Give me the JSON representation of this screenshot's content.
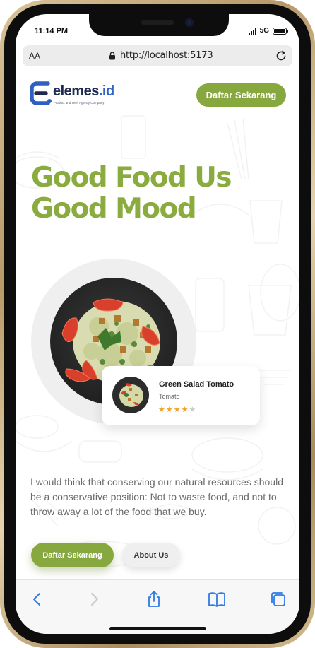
{
  "status_bar": {
    "time": "11:14 PM",
    "network": "5G",
    "battery_level": 1.0
  },
  "address_bar": {
    "text_size_label": "AA",
    "url": "http://localhost:5173"
  },
  "header": {
    "logo": {
      "name": "elemes",
      "suffix": ".id",
      "tagline": "Product and Tech Agency Company"
    },
    "cta_label": "Daftar Sekarang"
  },
  "hero": {
    "title_line1": "Good Food Us",
    "title_line2": "Good Mood"
  },
  "product_card": {
    "name": "Green Salad Tomato",
    "subtitle": "Tomato",
    "rating": 4,
    "rating_max": 5
  },
  "description": "I would think that conserving our natural resources should be a conservative position: Not to waste food, and not to throw away a lot of the food that we buy.",
  "actions": {
    "primary_label": "Daftar Sekarang",
    "secondary_label": "About Us"
  },
  "colors": {
    "accent_green": "#87a83e",
    "title_green": "#8aab3d",
    "star": "#f2a322",
    "browser_blue": "#2f7ae5"
  },
  "toolbar": {
    "icons": [
      "back-icon",
      "forward-icon",
      "share-icon",
      "bookmarks-icon",
      "tabs-icon"
    ]
  }
}
